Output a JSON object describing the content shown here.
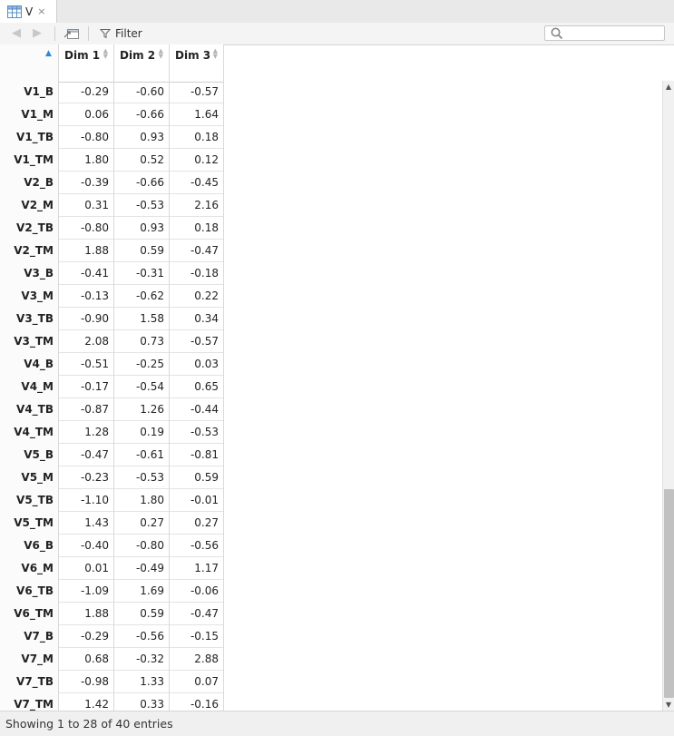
{
  "tab": {
    "title": "V",
    "icon": "table-icon",
    "close_glyph": "×"
  },
  "toolbar": {
    "back_icon": "back-arrow-icon",
    "forward_icon": "forward-arrow-icon",
    "popout_icon": "popout-window-icon",
    "filter_label": "Filter",
    "filter_icon": "funnel-icon",
    "search_icon": "search-icon",
    "search_value": ""
  },
  "table": {
    "columns": [
      "Dim 1",
      "Dim 2",
      "Dim 3"
    ],
    "rows": [
      {
        "name": "V1_B",
        "d1": "-0.29",
        "d2": "-0.60",
        "d3": "-0.57"
      },
      {
        "name": "V1_M",
        "d1": "0.06",
        "d2": "-0.66",
        "d3": "1.64"
      },
      {
        "name": "V1_TB",
        "d1": "-0.80",
        "d2": "0.93",
        "d3": "0.18"
      },
      {
        "name": "V1_TM",
        "d1": "1.80",
        "d2": "0.52",
        "d3": "0.12"
      },
      {
        "name": "V2_B",
        "d1": "-0.39",
        "d2": "-0.66",
        "d3": "-0.45"
      },
      {
        "name": "V2_M",
        "d1": "0.31",
        "d2": "-0.53",
        "d3": "2.16"
      },
      {
        "name": "V2_TB",
        "d1": "-0.80",
        "d2": "0.93",
        "d3": "0.18"
      },
      {
        "name": "V2_TM",
        "d1": "1.88",
        "d2": "0.59",
        "d3": "-0.47"
      },
      {
        "name": "V3_B",
        "d1": "-0.41",
        "d2": "-0.31",
        "d3": "-0.18"
      },
      {
        "name": "V3_M",
        "d1": "-0.13",
        "d2": "-0.62",
        "d3": "0.22"
      },
      {
        "name": "V3_TB",
        "d1": "-0.90",
        "d2": "1.58",
        "d3": "0.34"
      },
      {
        "name": "V3_TM",
        "d1": "2.08",
        "d2": "0.73",
        "d3": "-0.57"
      },
      {
        "name": "V4_B",
        "d1": "-0.51",
        "d2": "-0.25",
        "d3": "0.03"
      },
      {
        "name": "V4_M",
        "d1": "-0.17",
        "d2": "-0.54",
        "d3": "0.65"
      },
      {
        "name": "V4_TB",
        "d1": "-0.87",
        "d2": "1.26",
        "d3": "-0.44"
      },
      {
        "name": "V4_TM",
        "d1": "1.28",
        "d2": "0.19",
        "d3": "-0.53"
      },
      {
        "name": "V5_B",
        "d1": "-0.47",
        "d2": "-0.61",
        "d3": "-0.81"
      },
      {
        "name": "V5_M",
        "d1": "-0.23",
        "d2": "-0.53",
        "d3": "0.59"
      },
      {
        "name": "V5_TB",
        "d1": "-1.10",
        "d2": "1.80",
        "d3": "-0.01"
      },
      {
        "name": "V5_TM",
        "d1": "1.43",
        "d2": "0.27",
        "d3": "0.27"
      },
      {
        "name": "V6_B",
        "d1": "-0.40",
        "d2": "-0.80",
        "d3": "-0.56"
      },
      {
        "name": "V6_M",
        "d1": "0.01",
        "d2": "-0.49",
        "d3": "1.17"
      },
      {
        "name": "V6_TB",
        "d1": "-1.09",
        "d2": "1.69",
        "d3": "-0.06"
      },
      {
        "name": "V6_TM",
        "d1": "1.88",
        "d2": "0.59",
        "d3": "-0.47"
      },
      {
        "name": "V7_B",
        "d1": "-0.29",
        "d2": "-0.56",
        "d3": "-0.15"
      },
      {
        "name": "V7_M",
        "d1": "0.68",
        "d2": "-0.32",
        "d3": "2.88"
      },
      {
        "name": "V7_TB",
        "d1": "-0.98",
        "d2": "1.33",
        "d3": "0.07"
      },
      {
        "name": "V7_TM",
        "d1": "1.42",
        "d2": "0.33",
        "d3": "-0.16"
      }
    ]
  },
  "status": {
    "text": "Showing 1 to 28 of 40 entries"
  },
  "colors": {
    "sort_accent": "#2a8ad8",
    "scroll_thumb": "#c1c1c1"
  }
}
